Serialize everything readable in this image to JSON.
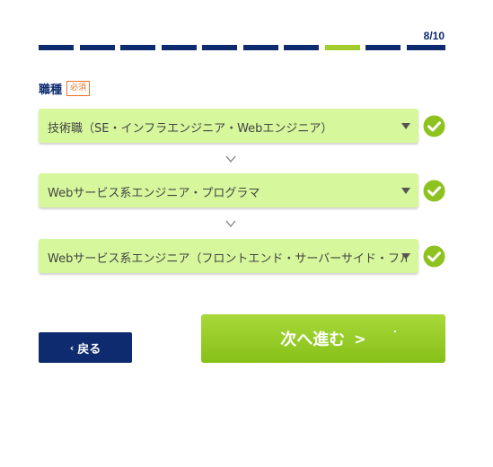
{
  "progress": {
    "counter": "8/10",
    "current_step": 8,
    "total_steps": 10,
    "done_color": "#0d2b6e",
    "current_color": "#a2cd2d"
  },
  "field": {
    "label": "職種",
    "required_badge": "必須"
  },
  "selects": [
    {
      "value": "技術職（SE・インフラエンジニア・Webエンジニア）",
      "checked": true
    },
    {
      "value": "Webサービス系エンジニア・プログラマ",
      "checked": true
    },
    {
      "value": "Webサービス系エンジニア（フロントエンド・サーバーサイド・フルスタック）",
      "checked": true
    }
  ],
  "buttons": {
    "back_label": "戻る",
    "next_label": "次へ進む"
  },
  "colors": {
    "select_bg": "#d6f79c",
    "check_green": "#8dc21f",
    "navy": "#0d2b6e",
    "next_green": "#86c017"
  },
  "icons": {
    "caret": "triangle-down",
    "check": "check-circle",
    "separator": "chevron-down",
    "back": "chevron-left",
    "next": "chevron-right"
  }
}
